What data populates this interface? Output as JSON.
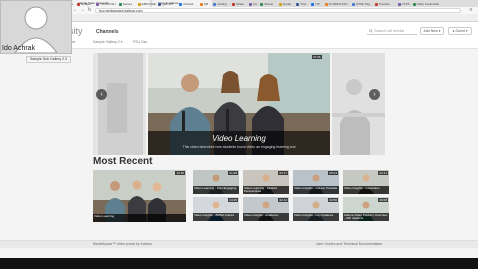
{
  "browser": {
    "tabs": [
      {
        "title": "Florida State University"
      },
      {
        "title": "Sample Kaltura"
      }
    ],
    "url": "fsu.mediaspace.kaltura.com",
    "bookmarks": [
      "Apps",
      "Budget",
      "YOUR FSU",
      "Secure",
      "EXPLORE",
      "gab 807",
      "Outlook",
      "Sfr",
      "Coding",
      "Share",
      "UC",
      "Status",
      "Email",
      "Thur",
      "ITF",
      "FLORIDA DIO",
      "HTML Tag",
      "Transfer",
      "CTSS",
      "Other bookmarks"
    ],
    "bookmark_colors": [
      "#4a7bd0",
      "#c0392b",
      "#7b5ea7",
      "#2e8b57",
      "#d4a017",
      "#3b5998",
      "#1a73e8",
      "#e67e22"
    ]
  },
  "header": {
    "site_name": "rsity",
    "nav_channels": "Channels",
    "search_placeholder": "Search all media",
    "add_new": "Add New",
    "guest": "Guest",
    "subnav": [
      "Home",
      "Sample Gallery 2 ▾",
      "FSU Gal..."
    ]
  },
  "carousel": {
    "title": "Video Learning",
    "description": "This video describes how students found video an engaging learning tool",
    "badge": "10:36",
    "prev": "‹",
    "next": "›"
  },
  "recent": {
    "title": "Most Recent",
    "featured": {
      "caption": "Video Learning",
      "badge": "10:36"
    },
    "items": [
      {
        "caption": "Video Learning - Inter Engaging",
        "badge": "01:28"
      },
      {
        "caption": "Video Learning - Student Perspectives",
        "badge": "03:17"
      },
      {
        "caption": "Video Insights - GoLive Tutorials",
        "badge": "05:24"
      },
      {
        "caption": "Video Insights - Integration",
        "badge": "02:41"
      },
      {
        "caption": "Video Insights - BMSA Culture",
        "badge": "04:05"
      },
      {
        "caption": "Video Insights - Academic",
        "badge": "02:12"
      },
      {
        "caption": "Video Insights - Key Features",
        "badge": "03:50"
      },
      {
        "caption": "Kaltura Video Platform Overview - with captions",
        "badge": "06:08"
      }
    ]
  },
  "footer": {
    "left": "MediaSpace™ video portal by Kaltura",
    "right": "User Guides and Technical Documentation"
  },
  "webcam": {
    "name": "Ido Achrak",
    "subtitle": "Sample Sub Gallery 2.3"
  }
}
